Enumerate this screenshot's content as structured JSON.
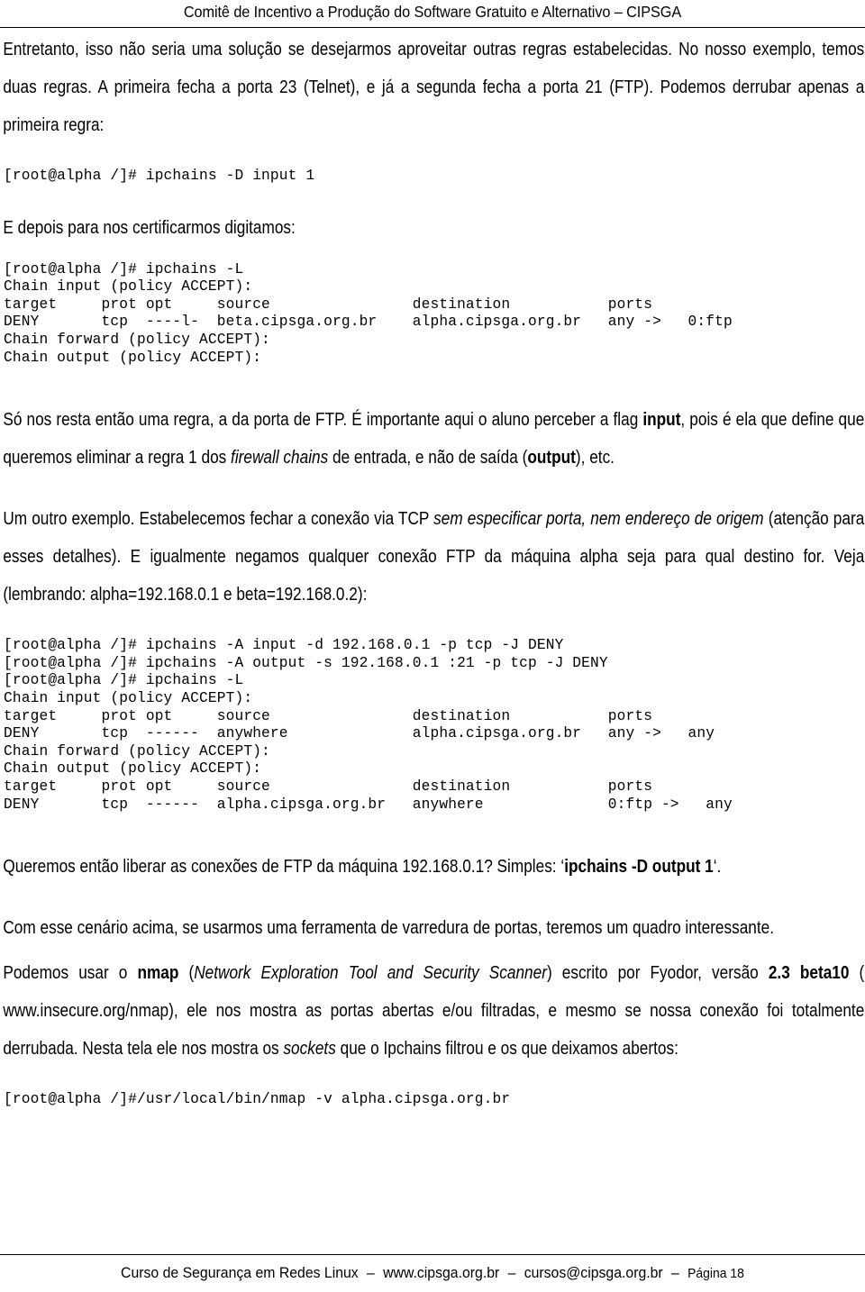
{
  "header": {
    "title": "Comitê de Incentivo a Produção do Software Gratuito e Alternativo – CIPSGA"
  },
  "body": {
    "p1_a": "Entretanto, isso não seria uma solução se desejarmos aproveitar outras regras estabelecidas. No nosso exemplo, temos duas regras. A primeira fecha a porta 23 (Telnet), e já a segunda fecha a porta 21 (FTP). Podemos derrubar apenas a primeira regra:",
    "code1": "[root@alpha /]# ipchains -D input 1",
    "p2": "E depois para nos certificarmos digitamos:",
    "code2": "[root@alpha /]# ipchains -L\nChain input (policy ACCEPT):\ntarget     prot opt     source                destination           ports\nDENY       tcp  ----l-  beta.cipsga.org.br    alpha.cipsga.org.br   any ->   0:ftp\nChain forward (policy ACCEPT):\nChain output (policy ACCEPT):",
    "p3_pre": "Só nos resta então uma regra, a da porta de FTP. É importante aqui o aluno perceber a flag ",
    "p3_b1": "input",
    "p3_mid": ", pois é ela que define que queremos eliminar a regra 1 dos ",
    "p3_i1": "firewall chains",
    "p3_mid2": " de entrada, e não de saída (",
    "p3_b2": "output",
    "p3_end": "), etc.",
    "p4_pre": "Um outro exemplo. Estabelecemos fechar a conexão via TCP ",
    "p4_i1": "sem especificar porta, nem endereço de origem",
    "p4_end": " (atenção para esses detalhes). E igualmente negamos qualquer conexão FTP da máquina alpha seja para qual destino for. Veja (lembrando: alpha=192.168.0.1 e beta=192.168.0.2):",
    "code3": "[root@alpha /]# ipchains -A input -d 192.168.0.1 -p tcp -J DENY\n[root@alpha /]# ipchains -A output -s 192.168.0.1 :21 -p tcp -J DENY\n[root@alpha /]# ipchains -L\nChain input (policy ACCEPT):\ntarget     prot opt     source                destination           ports\nDENY       tcp  ------  anywhere              alpha.cipsga.org.br   any ->   any\nChain forward (policy ACCEPT):\nChain output (policy ACCEPT):\ntarget     prot opt     source                destination           ports\nDENY       tcp  ------  alpha.cipsga.org.br   anywhere              0:ftp ->   any",
    "p5_pre": "Queremos então liberar as conexões de FTP da máquina 192.168.0.1? Simples: ‘",
    "p5_b1": "ipchains -D output 1",
    "p5_end": "‘.",
    "p6": "Com esse cenário acima, se usarmos uma ferramenta de varredura de portas, teremos um quadro interessante.",
    "p7_pre": "Podemos usar o ",
    "p7_b1": "nmap",
    "p7_mid": " (",
    "p7_i1": "Network Exploration Tool and Security Scanner",
    "p7_mid2": ") escrito por Fyodor, versão ",
    "p7_b2": "2.3 beta10",
    "p7_mid3": " ( www.insecure.org/nmap), ele nos mostra as portas abertas e/ou filtradas, e mesmo se nossa conexão foi totalmente derrubada. Nesta tela ele nos mostra os ",
    "p7_i2": "sockets",
    "p7_end": " que o Ipchains filtrou e os que deixamos abertos:",
    "code4": "[root@alpha /]#/usr/local/bin/nmap -v alpha.cipsga.org.br"
  },
  "footer": {
    "course": "Curso de Segurança em Redes Linux",
    "dash1": "–",
    "website": "www.cipsga.org.br",
    "dash2": "–",
    "email": "cursos@cipsga.org.br",
    "dash3": "–",
    "page": "Página 18"
  }
}
